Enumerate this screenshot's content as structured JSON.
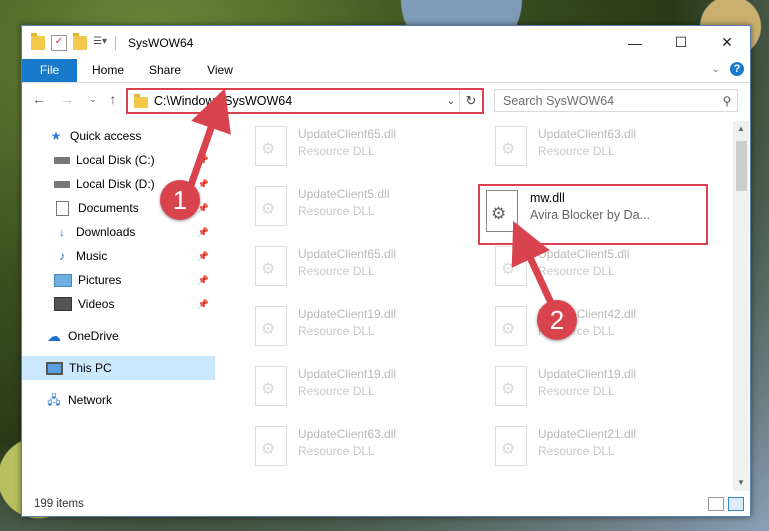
{
  "window": {
    "title": "SysWOW64",
    "controls": {
      "minimize": "—",
      "maximize": "☐",
      "close": "✕"
    }
  },
  "ribbon": {
    "tabs": [
      "File",
      "Home",
      "Share",
      "View"
    ]
  },
  "address_bar": {
    "path": "C:\\Windows\\SysWOW64",
    "search_placeholder": "Search SysWOW64"
  },
  "nav_pane": {
    "items": [
      {
        "label": "Quick access",
        "icon": "star-icon"
      },
      {
        "label": "Local Disk (C:)",
        "icon": "drive-icon",
        "pinned": true
      },
      {
        "label": "Local Disk (D:)",
        "icon": "drive-icon",
        "pinned": true
      },
      {
        "label": "Documents",
        "icon": "documents-icon",
        "pinned": true
      },
      {
        "label": "Downloads",
        "icon": "download-icon",
        "pinned": true
      },
      {
        "label": "Music",
        "icon": "music-icon",
        "pinned": true
      },
      {
        "label": "Pictures",
        "icon": "pictures-icon",
        "pinned": true
      },
      {
        "label": "Videos",
        "icon": "videos-icon",
        "pinned": true
      },
      {
        "label": "OneDrive",
        "icon": "cloud-icon"
      },
      {
        "label": "This PC",
        "icon": "computer-icon",
        "selected": true
      },
      {
        "label": "Network",
        "icon": "network-icon"
      }
    ]
  },
  "files": [
    {
      "name": "UpdateClient65.dll",
      "desc": "Resource DLL"
    },
    {
      "name": "UpdateClient63.dll",
      "desc": "Resource DLL"
    },
    {
      "name": "UpdateClient5.dll",
      "desc": "Resource DLL"
    },
    {
      "name": "UpdateClient65.dll",
      "desc": "Resource DLL"
    },
    {
      "name": "UpdateClient5.dll",
      "desc": "Resource DLL"
    },
    {
      "name": "UpdateClient19.dll",
      "desc": "Resource DLL"
    },
    {
      "name": "UpdateClient42.dll",
      "desc": "Resource DLL"
    },
    {
      "name": "UpdateClient19.dll",
      "desc": "Resource DLL"
    },
    {
      "name": "UpdateClient19.dll",
      "desc": "Resource DLL"
    },
    {
      "name": "UpdateClient63.dll",
      "desc": "Resource DLL"
    },
    {
      "name": "UpdateClient21.dll",
      "desc": "Resource DLL"
    }
  ],
  "highlighted_file": {
    "name": "mw.dll",
    "desc": "Avira Blocker by Da..."
  },
  "status": {
    "item_count": "199 items"
  },
  "callouts": {
    "first": "1",
    "second": "2"
  },
  "colors": {
    "accent": "#1979ca",
    "callout": "#d9434e"
  }
}
